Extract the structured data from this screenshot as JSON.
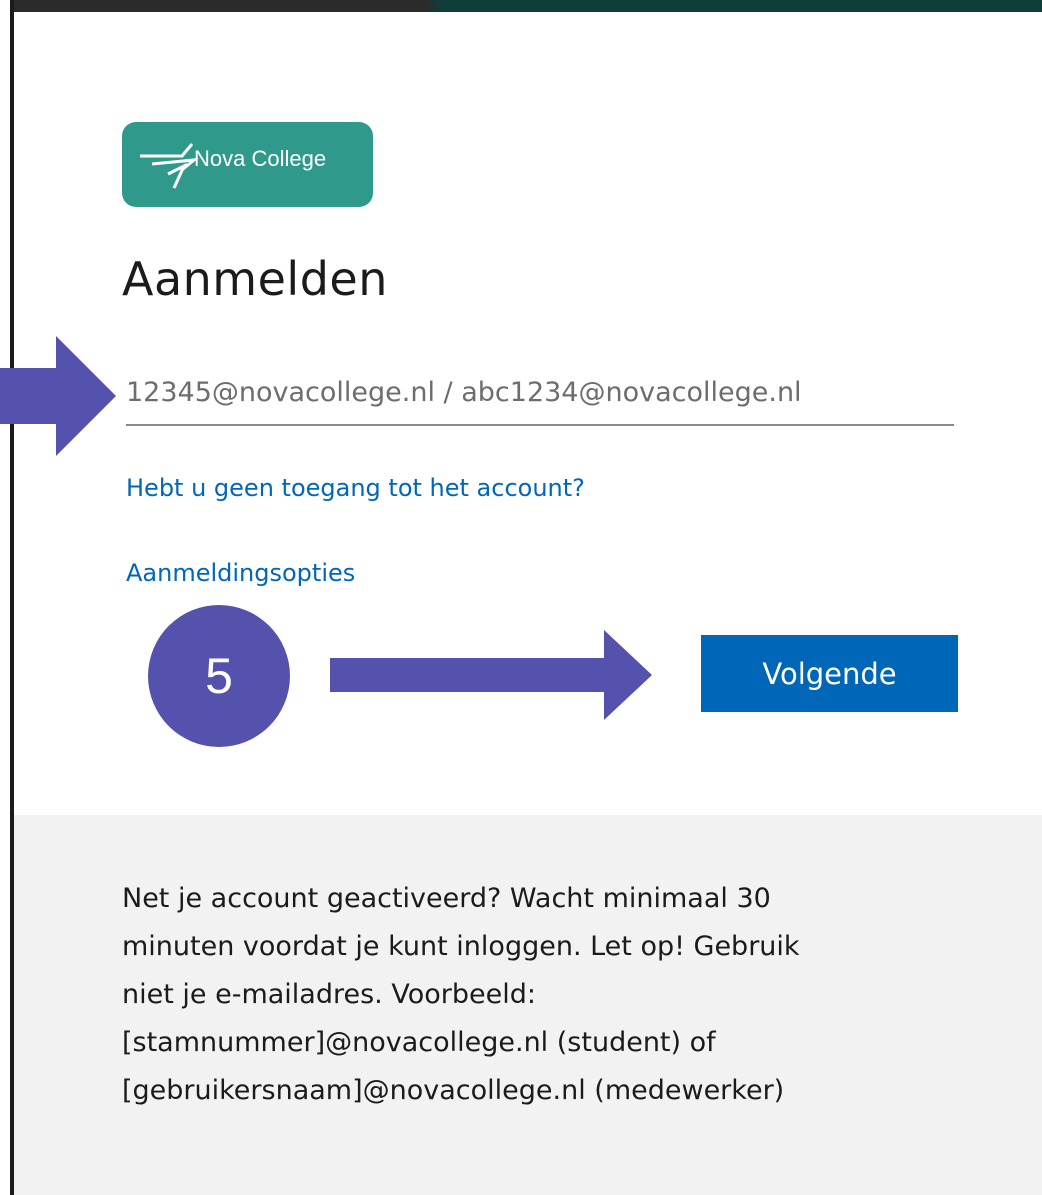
{
  "logo": {
    "text": "Nova College"
  },
  "title": "Aanmelden",
  "email_field": {
    "placeholder": "12345@novacollege.nl / abc1234@novacollege.nl",
    "value": ""
  },
  "links": {
    "no_access": "Hebt u geen toegang tot het account?",
    "signin_options": "Aanmeldingsopties"
  },
  "next_button": "Volgende",
  "annotation": {
    "step_number": "5"
  },
  "info": {
    "lines": [
      "Net je account geactiveerd? Wacht minimaal 30",
      "minuten voordat je kunt inloggen. Let op! Gebruik",
      "niet je e-mailadres. Voorbeeld:",
      "[stamnummer]@novacollege.nl (student) of",
      "[gebruikersnaam]@novacollege.nl (medewerker)"
    ]
  },
  "colors": {
    "accent": "#0067b8",
    "logo_bg": "#2f9a8c",
    "annotation": "#5552ae",
    "info_bg": "#f2f2f2"
  }
}
